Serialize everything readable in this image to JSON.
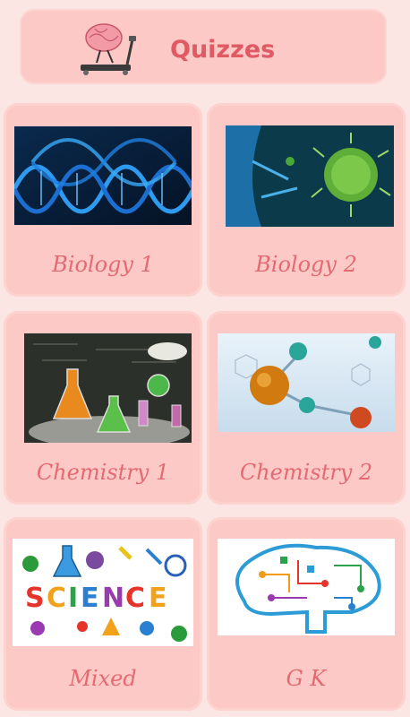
{
  "header": {
    "title": "Quizzes",
    "icon": "brain-treadmill-icon"
  },
  "quizzes": [
    {
      "label": "Biology 1",
      "image": "dna-helix-image"
    },
    {
      "label": "Biology 2",
      "image": "virus-cell-image"
    },
    {
      "label": "Chemistry 1",
      "image": "lab-flasks-image"
    },
    {
      "label": "Chemistry 2",
      "image": "molecules-image"
    },
    {
      "label": "Mixed",
      "image": "science-words-image"
    },
    {
      "label": "G K",
      "image": "brain-circuit-image"
    }
  ],
  "colors": {
    "background": "#fce6e4",
    "card": "#fcc9c6",
    "title": "#e05a63",
    "label": "#e36a72"
  }
}
